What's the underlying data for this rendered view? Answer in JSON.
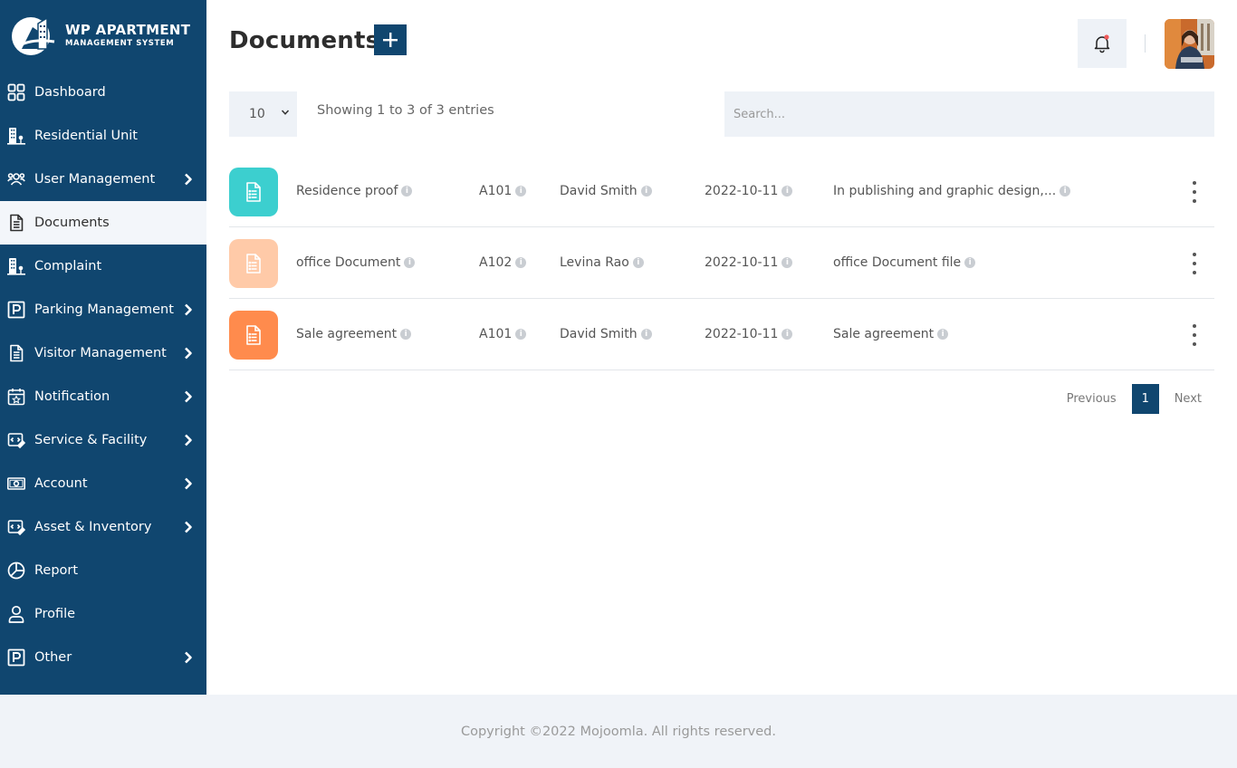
{
  "brand": {
    "title": "WP APARTMENT",
    "subtitle": "MANAGEMENT SYSTEM"
  },
  "sidebar": {
    "items": [
      {
        "label": "Dashboard",
        "icon": "grid-icon",
        "has_arrow": false,
        "active": false
      },
      {
        "label": "Residential Unit",
        "icon": "building-icon",
        "has_arrow": false,
        "active": false
      },
      {
        "label": "User Management",
        "icon": "users-icon",
        "has_arrow": true,
        "active": false
      },
      {
        "label": "Documents",
        "icon": "document-icon",
        "has_arrow": false,
        "active": true
      },
      {
        "label": "Complaint",
        "icon": "building-icon",
        "has_arrow": false,
        "active": false
      },
      {
        "label": "Parking Management",
        "icon": "parking-icon",
        "has_arrow": true,
        "active": false
      },
      {
        "label": "Visitor Management",
        "icon": "document-icon",
        "has_arrow": true,
        "active": false
      },
      {
        "label": "Notification",
        "icon": "calendar-star-icon",
        "has_arrow": true,
        "active": false
      },
      {
        "label": "Service & Facility",
        "icon": "service-icon",
        "has_arrow": true,
        "active": false
      },
      {
        "label": "Account",
        "icon": "money-icon",
        "has_arrow": true,
        "active": false
      },
      {
        "label": "Asset & Inventory",
        "icon": "service-icon",
        "has_arrow": true,
        "active": false
      },
      {
        "label": "Report",
        "icon": "pie-chart-icon",
        "has_arrow": false,
        "active": false
      },
      {
        "label": "Profile",
        "icon": "user-icon",
        "has_arrow": false,
        "active": false
      },
      {
        "label": "Other",
        "icon": "parking-icon",
        "has_arrow": true,
        "active": false
      }
    ]
  },
  "header": {
    "title": "Documents",
    "add_label": "+"
  },
  "table_controls": {
    "page_length": "10",
    "showing_text": "Showing 1 to 3 of 3 entries",
    "search_placeholder": "Search..."
  },
  "documents": [
    {
      "icon_color": "#3ccfcf",
      "title": "Residence proof",
      "unit": "A101",
      "member": "David Smith",
      "date": "2022-10-11",
      "description": "In publishing and graphic design,..."
    },
    {
      "icon_color": "#ffcaa8",
      "title": "office Document",
      "unit": "A102",
      "member": "Levina Rao",
      "date": "2022-10-11",
      "description": "office Document file"
    },
    {
      "icon_color": "#ff8b4d",
      "title": "Sale agreement",
      "unit": "A101",
      "member": "David Smith",
      "date": "2022-10-11",
      "description": "Sale agreement"
    }
  ],
  "pagination": {
    "previous": "Previous",
    "current": "1",
    "next": "Next"
  },
  "footer": {
    "copyright": "Copyright ©2022 Mojoomla. All rights reserved."
  },
  "colors": {
    "primary": "#10466f",
    "background_light": "#eef2f7",
    "notification_dot": "#f05a5a"
  }
}
